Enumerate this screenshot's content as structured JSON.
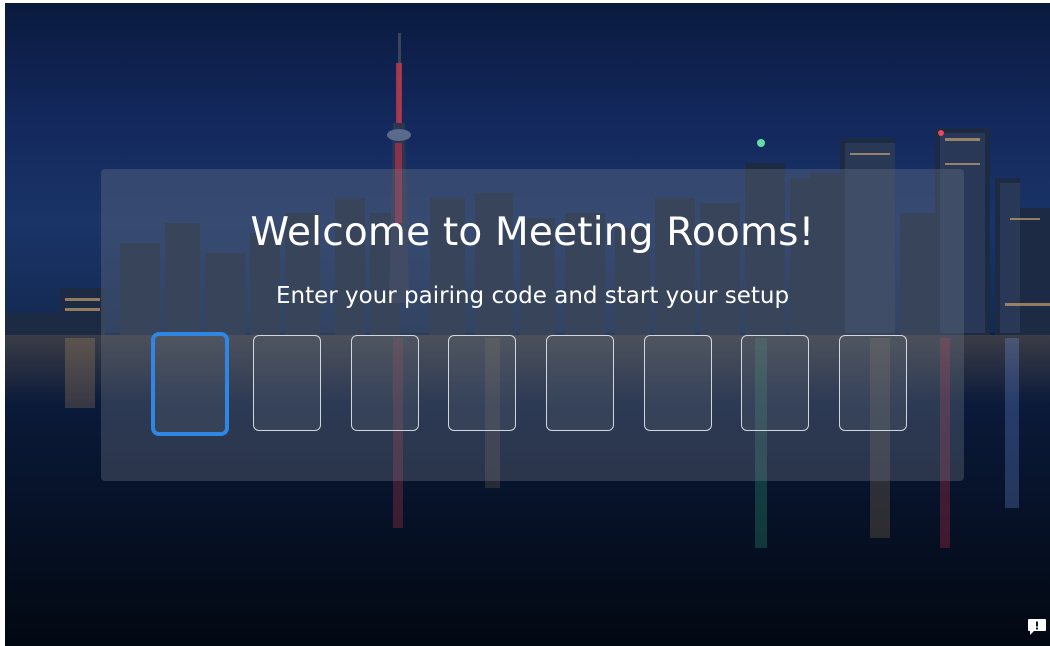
{
  "welcome": {
    "title": "Welcome to Meeting Rooms!",
    "subtitle": "Enter your pairing code and start your setup"
  },
  "pairing_code": {
    "length": 8,
    "values": [
      "",
      "",
      "",
      "",
      "",
      "",
      "",
      ""
    ],
    "focused_index": 0
  },
  "colors": {
    "focus_border": "#2f86e3",
    "box_border": "#ebf0f8",
    "text": "#ffffff"
  },
  "icons": {
    "feedback": "feedback-icon"
  }
}
